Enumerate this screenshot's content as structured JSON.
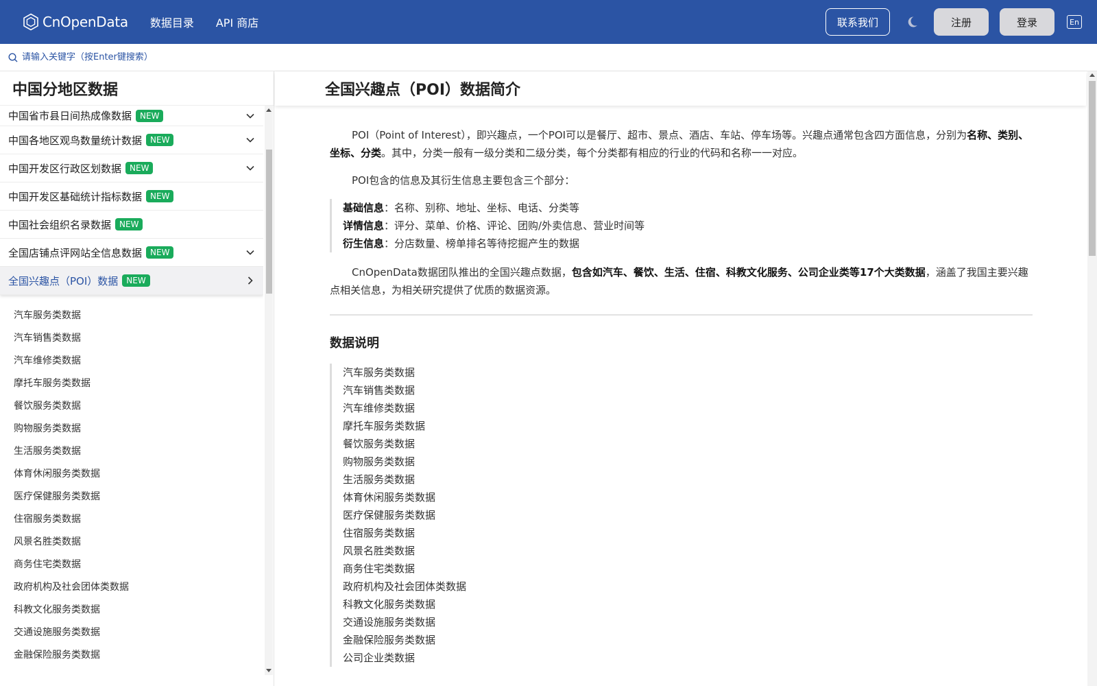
{
  "header": {
    "brand": "CnOpenData",
    "nav": [
      "数据目录",
      "API 商店"
    ],
    "contact_label": "联系我们",
    "register_label": "注册",
    "login_label": "登录",
    "lang_label": "En",
    "bg_color": "#2b54a4"
  },
  "search": {
    "placeholder": "请输入关键字（按Enter键搜索）"
  },
  "sidebar": {
    "title": "中国分地区数据",
    "items": [
      {
        "label": "中国省市县日间热成像数据",
        "badge": "NEW",
        "icon": "chevron-down-icon"
      },
      {
        "label": "中国各地区观鸟数量统计数据",
        "badge": "NEW",
        "icon": "chevron-down-icon"
      },
      {
        "label": "中国开发区行政区划数据",
        "badge": "NEW",
        "icon": "chevron-down-icon"
      },
      {
        "label": "中国开发区基础统计指标数据",
        "badge": "NEW",
        "icon": ""
      },
      {
        "label": "中国社会组织名录数据",
        "badge": "NEW",
        "icon": ""
      },
      {
        "label": "全国店铺点评网站全信息数据",
        "badge": "NEW",
        "icon": "chevron-down-icon"
      },
      {
        "label": "全国兴趣点（POI）数据",
        "badge": "NEW",
        "icon": "chevron-right-icon"
      }
    ],
    "sub_items": [
      "汽车服务类数据",
      "汽车销售类数据",
      "汽车维修类数据",
      "摩托车服务类数据",
      "餐饮服务类数据",
      "购物服务类数据",
      "生活服务类数据",
      "体育休闲服务类数据",
      "医疗保健服务类数据",
      "住宿服务类数据",
      "风景名胜类数据",
      "商务住宅类数据",
      "政府机构及社会团体类数据",
      "科教文化服务类数据",
      "交通设施服务类数据",
      "金融保险服务类数据"
    ]
  },
  "main": {
    "title": "全国兴趣点（POI）数据简介",
    "intro_pre": "POI（Point of Interest），即兴趣点，一个POI可以是餐厅、超市、景点、酒店、车站、停车场等。兴趣点通常包含四方面信息，分别为",
    "intro_bold": "名称、类别、坐标、分类",
    "intro_post": "。其中，分类一般有一级分类和二级分类，每个分类都有相应的行业的代码和名称一一对应。",
    "poi_parts_intro": "POI包含的信息及其衍生信息主要包含三个部分：",
    "info_rows": [
      {
        "key": "基础信息",
        "value": "：名称、别称、地址、坐标、电话、分类等"
      },
      {
        "key": "详情信息",
        "value": "：评分、菜单、价格、评论、团购/外卖信息、营业时间等"
      },
      {
        "key": "衍生信息",
        "value": "：分店数量、榜单排名等待挖掘产生的数据"
      }
    ],
    "team_pre": "CnOpenData数据团队推出的全国兴趣点数据，",
    "team_bold": "包含如汽车、餐饮、生活、住宿、科教文化服务、公司企业类等17个大类数据",
    "team_post": "，涵盖了我国主要兴趣点相关信息，为相关研究提供了优质的数据资源。",
    "section_title": "数据说明",
    "data_list": [
      "汽车服务类数据",
      "汽车销售类数据",
      "汽车维修类数据",
      "摩托车服务类数据",
      "餐饮服务类数据",
      "购物服务类数据",
      "生活服务类数据",
      "体育休闲服务类数据",
      "医疗保健服务类数据",
      "住宿服务类数据",
      "风景名胜类数据",
      "商务住宅类数据",
      "政府机构及社会团体类数据",
      "科教文化服务类数据",
      "交通设施服务类数据",
      "金融保险服务类数据",
      "公司企业类数据"
    ]
  }
}
